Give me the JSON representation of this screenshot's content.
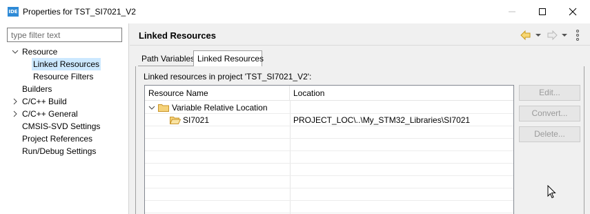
{
  "window": {
    "app_icon_text": "IDE",
    "title": "Properties for TST_SI7021_V2"
  },
  "sidebar": {
    "filter_placeholder": "type filter text",
    "items": [
      {
        "label": "Resource",
        "expanded": true
      },
      {
        "label": "Linked Resources",
        "selected": true
      },
      {
        "label": "Resource Filters"
      },
      {
        "label": "Builders"
      },
      {
        "label": "C/C++ Build",
        "collapsed": true
      },
      {
        "label": "C/C++ General",
        "collapsed": true
      },
      {
        "label": "CMSIS-SVD Settings"
      },
      {
        "label": "Project References"
      },
      {
        "label": "Run/Debug Settings"
      }
    ]
  },
  "main": {
    "title": "Linked Resources",
    "tabs": [
      {
        "label": "Path Variables"
      },
      {
        "label": "Linked Resources",
        "active": true
      }
    ],
    "project_label": "Linked resources in project 'TST_SI7021_V2':",
    "table": {
      "columns": [
        "Resource Name",
        "Location"
      ],
      "rows": [
        {
          "name": "Variable Relative Location",
          "location": "",
          "type": "group"
        },
        {
          "name": "SI7021",
          "location": "PROJECT_LOC\\..\\My_STM32_Libraries\\SI7021",
          "type": "folder"
        }
      ]
    },
    "buttons": {
      "edit": "Edit...",
      "convert": "Convert...",
      "delete": "Delete..."
    }
  },
  "colors": {
    "selection": "#cce8ff",
    "folder": "#e8b34a",
    "nav_back": "#d4a020",
    "app_icon": "#2e8ad6"
  }
}
